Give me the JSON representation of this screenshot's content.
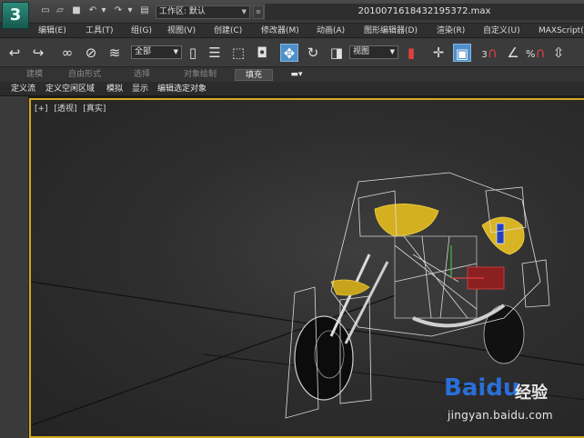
{
  "titlebar": {
    "app_logo": "3",
    "workspace_label": "工作区: 默认",
    "filename": "2010071618432195372.max"
  },
  "menu": {
    "items": [
      "编辑(E)",
      "工具(T)",
      "组(G)",
      "视图(V)",
      "创建(C)",
      "修改器(M)",
      "动画(A)",
      "图形编辑器(D)",
      "渲染(R)",
      "自定义(U)",
      "MAXScript("
    ]
  },
  "toolbar": {
    "selection_filter": "全部",
    "reference_coord": "视图",
    "snap_3_label": "3",
    "snap_percent_label": "%"
  },
  "ribbon": {
    "tabs": [
      "建模",
      "自由形式",
      "选择",
      "对象绘制",
      "填充"
    ],
    "active_tab": "填充"
  },
  "subribbon": {
    "items": [
      "定义流",
      "定义空闲区域",
      "模拟",
      "显示",
      "编辑选定对象"
    ]
  },
  "viewport": {
    "labels": [
      "[+]",
      "[透视]",
      "[真实]"
    ],
    "border_color": "#d4a820"
  },
  "watermark": {
    "logo": "Bai",
    "logo_paw": "du",
    "text": "经验",
    "url": "jingyan.baidu.com"
  }
}
